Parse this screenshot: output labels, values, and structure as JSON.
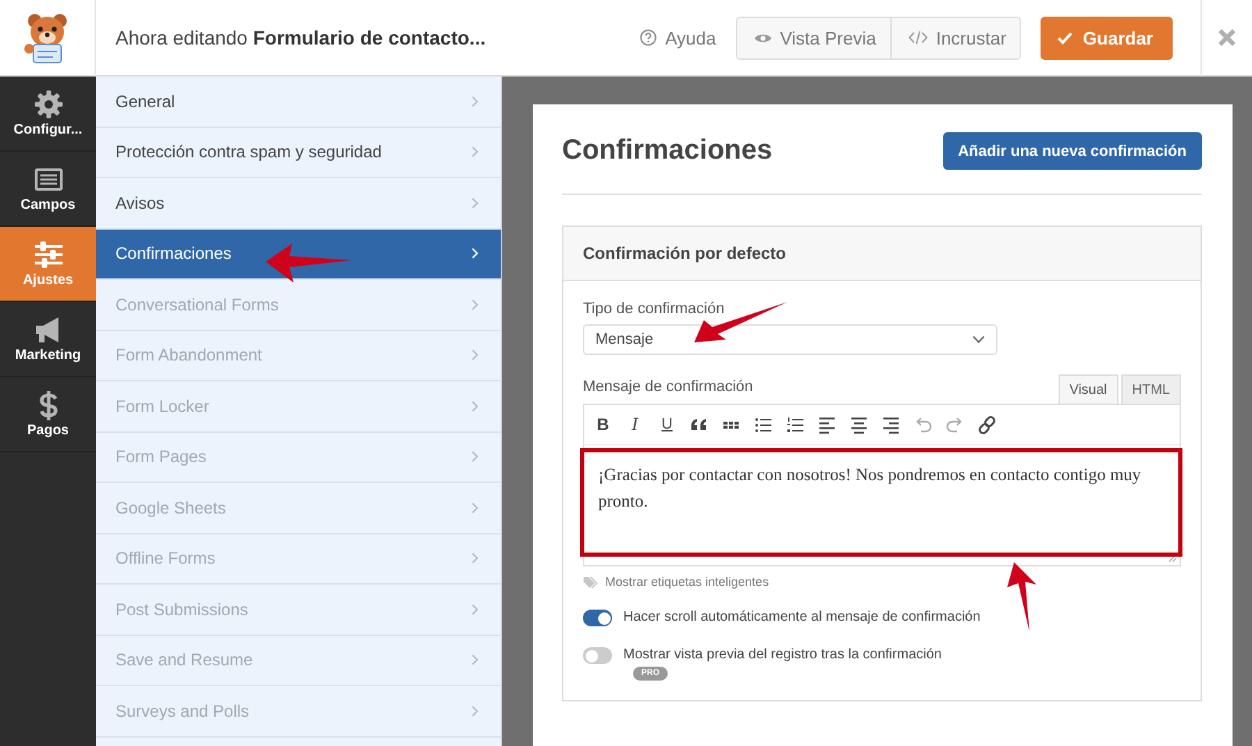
{
  "header": {
    "title": "Ahora editando **Formulario de contacto...**",
    "help": "Ayuda",
    "preview": "Vista Previa",
    "embed": "Incrustar",
    "save": "Guardar"
  },
  "nav": [
    {
      "label": "Configur...",
      "kind": "gear",
      "selected": false
    },
    {
      "label": "Campos",
      "kind": "fields",
      "selected": false
    },
    {
      "label": "Ajustes",
      "kind": "sliders",
      "selected": true
    },
    {
      "label": "Marketing",
      "kind": "megaphone",
      "selected": false
    },
    {
      "label": "Pagos",
      "kind": "dollar",
      "selected": false
    }
  ],
  "settings_menu": [
    {
      "label": "General",
      "selected": false,
      "disabled": false
    },
    {
      "label": "Protección contra spam y seguridad",
      "selected": false,
      "disabled": false
    },
    {
      "label": "Avisos",
      "selected": false,
      "disabled": false
    },
    {
      "label": "Confirmaciones",
      "selected": true,
      "disabled": false
    },
    {
      "label": "Conversational Forms",
      "selected": false,
      "disabled": true
    },
    {
      "label": "Form Abandonment",
      "selected": false,
      "disabled": true
    },
    {
      "label": "Form Locker",
      "selected": false,
      "disabled": true
    },
    {
      "label": "Form Pages",
      "selected": false,
      "disabled": true
    },
    {
      "label": "Google Sheets",
      "selected": false,
      "disabled": true
    },
    {
      "label": "Offline Forms",
      "selected": false,
      "disabled": true
    },
    {
      "label": "Post Submissions",
      "selected": false,
      "disabled": true
    },
    {
      "label": "Save and Resume",
      "selected": false,
      "disabled": true
    },
    {
      "label": "Surveys and Polls",
      "selected": false,
      "disabled": true
    }
  ],
  "panel": {
    "title": "Confirmaciones",
    "add_button": "Añadir una nueva confirmación",
    "section": {
      "title": "Confirmación por defecto",
      "type_label": "Tipo de confirmación",
      "type_value": "Mensaje",
      "message_label": "Mensaje de confirmación",
      "editor_tabs": [
        {
          "label": "Visual",
          "selected": true
        },
        {
          "label": "HTML",
          "selected": false
        }
      ],
      "toolbar": [
        {
          "kind": "bold",
          "label": "B"
        },
        {
          "kind": "italic",
          "label": "I"
        },
        {
          "kind": "underline",
          "label": "U"
        },
        {
          "kind": "quote"
        },
        {
          "kind": "strike"
        },
        {
          "kind": "bullets"
        },
        {
          "kind": "numbers"
        },
        {
          "kind": "align-left"
        },
        {
          "kind": "align-center"
        },
        {
          "kind": "align-right"
        },
        {
          "kind": "undo"
        },
        {
          "kind": "redo"
        },
        {
          "kind": "link"
        }
      ],
      "message": "¡Gracias por contactar con nosotros! Nos pondremos en contacto contigo muy pronto.",
      "smart_tags": "Mostrar etiquetas inteligentes",
      "toggles": [
        {
          "label": "Hacer scroll automáticamente al mensaje de confirmación",
          "on": true
        },
        {
          "label": "Mostrar vista previa del registro tras la confirmación",
          "on": false,
          "badge": "PRO"
        }
      ]
    }
  },
  "annotations": [
    {
      "kind": "arrow-left"
    },
    {
      "kind": "arrow-down-left"
    },
    {
      "kind": "frame"
    },
    {
      "kind": "arrow-up"
    }
  ]
}
